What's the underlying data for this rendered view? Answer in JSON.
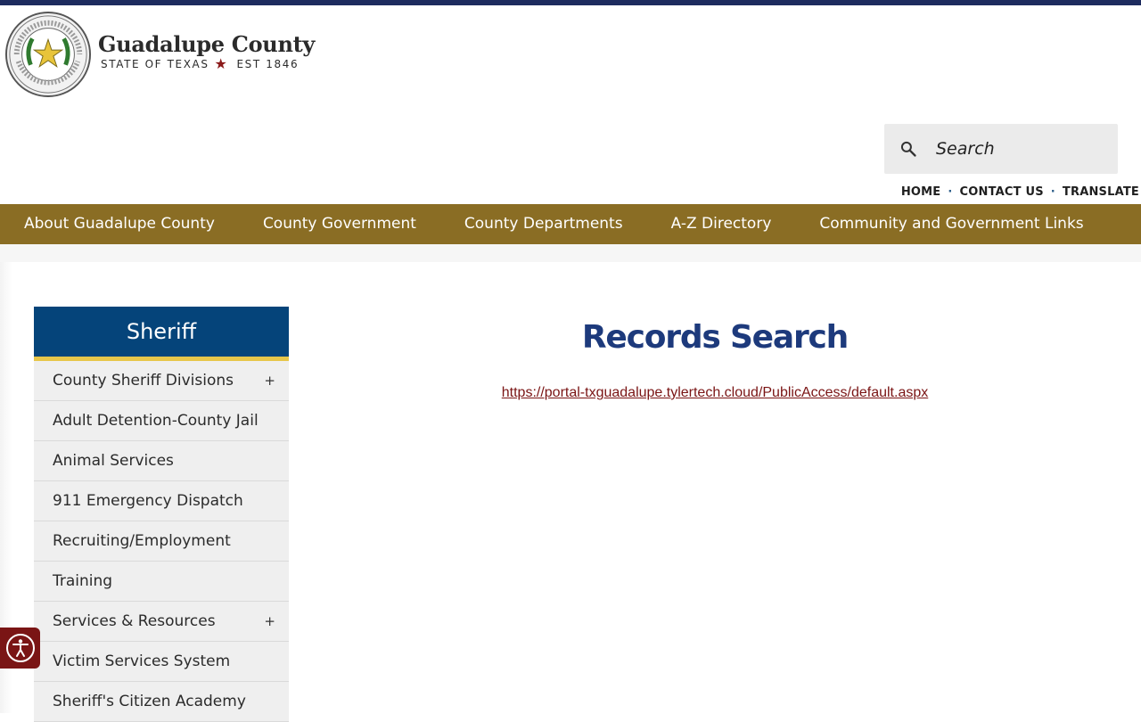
{
  "header": {
    "logo_title": "Guadalupe County",
    "logo_state": "STATE OF TEXAS",
    "logo_est": "EST 1846",
    "seal_icon": "texas-county-seal-icon",
    "star_icon": "star-icon"
  },
  "search": {
    "placeholder": "Search",
    "icon": "search-icon"
  },
  "utility_nav": {
    "home": "HOME",
    "contact": "CONTACT US",
    "translate": "TRANSLATE",
    "separator": "·"
  },
  "main_nav": {
    "items": [
      {
        "label": "About Guadalupe County"
      },
      {
        "label": "County Government"
      },
      {
        "label": "County Departments"
      },
      {
        "label": "A-Z Directory"
      },
      {
        "label": "Community and Government Links"
      }
    ]
  },
  "sidebar": {
    "title": "Sheriff",
    "items": [
      {
        "label": "County Sheriff Divisions",
        "expand": "+"
      },
      {
        "label": "Adult Detention-County Jail"
      },
      {
        "label": "Animal Services"
      },
      {
        "label": "911 Emergency Dispatch"
      },
      {
        "label": "Recruiting/Employment"
      },
      {
        "label": "Training"
      },
      {
        "label": "Services & Resources",
        "expand": "+"
      },
      {
        "label": "Victim Services System"
      },
      {
        "label": "Sheriff's Citizen Academy"
      }
    ]
  },
  "content": {
    "title": "Records Search",
    "link_text": "https://portal-txguadalupe.tylertech.cloud/PublicAccess/default.aspx"
  },
  "accessibility": {
    "icon": "accessibility-icon"
  },
  "colors": {
    "top_bar": "#1d2b5e",
    "nav_bg": "#8a6d24",
    "sidebar_title_bg": "#05447a",
    "sidebar_accent": "#e7c64a",
    "title_color": "#1d3a7c",
    "link_color": "#7a1414",
    "a11y_bg": "#7a1515"
  }
}
